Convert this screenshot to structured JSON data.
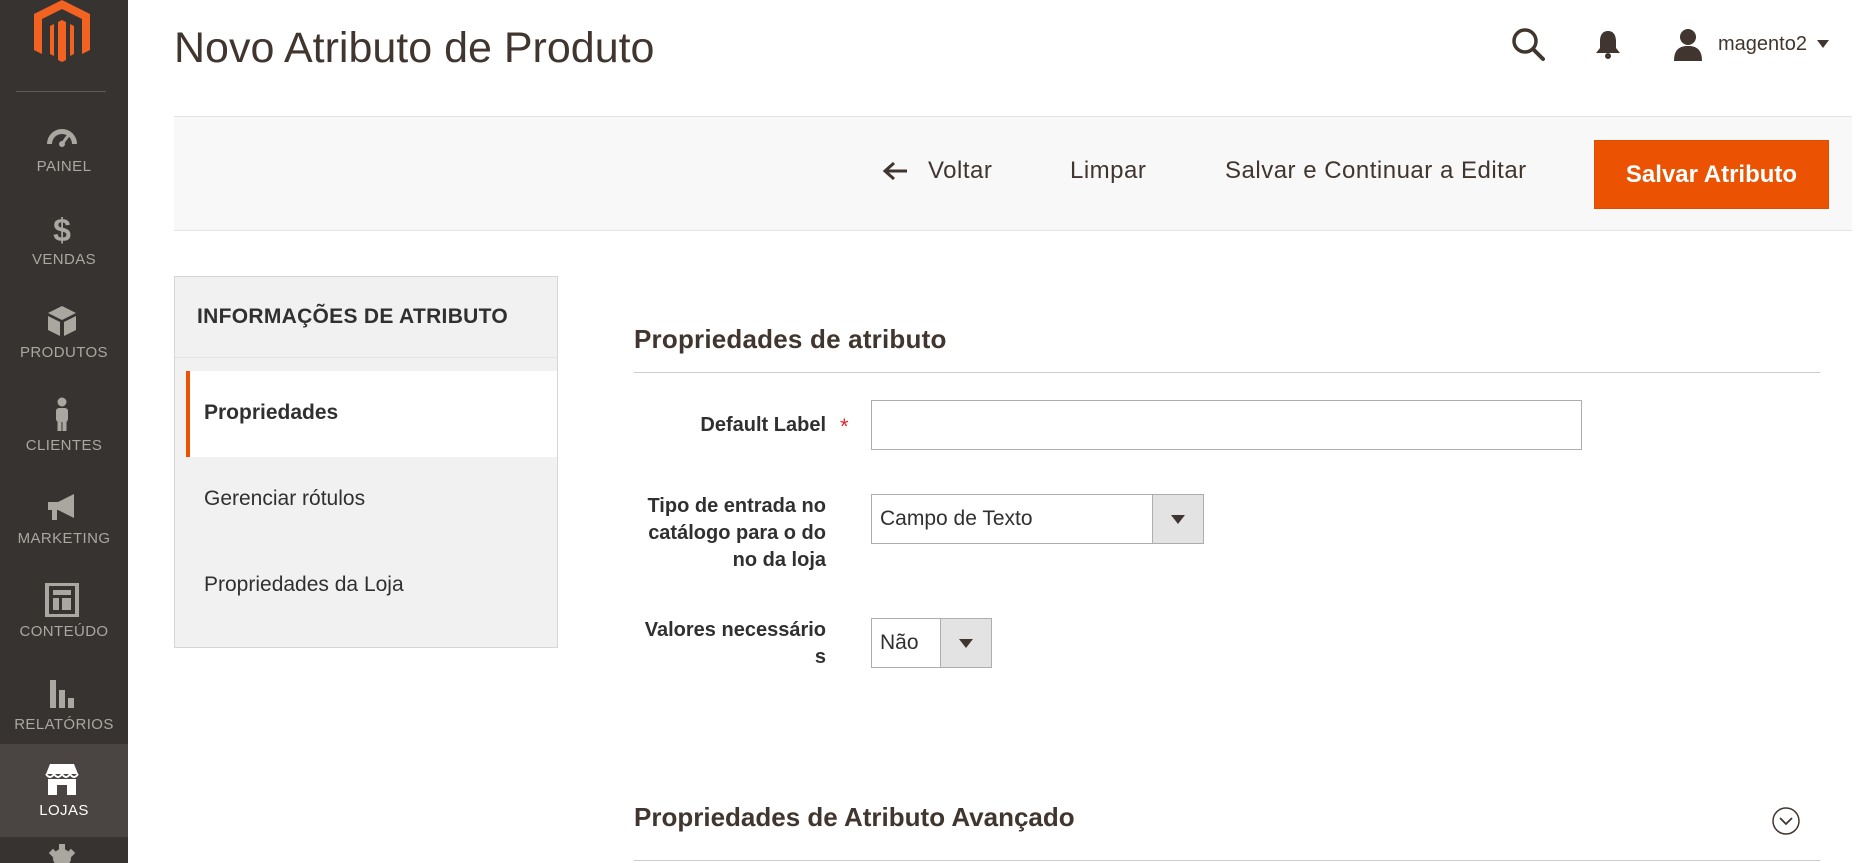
{
  "sidebar": {
    "items": [
      {
        "label": "PAINEL",
        "icon": "dashboard-icon"
      },
      {
        "label": "VENDAS",
        "icon": "dollar-icon"
      },
      {
        "label": "PRODUTOS",
        "icon": "box-icon"
      },
      {
        "label": "CLIENTES",
        "icon": "person-icon"
      },
      {
        "label": "MARKETING",
        "icon": "megaphone-icon"
      },
      {
        "label": "CONTEÚDO",
        "icon": "layout-icon"
      },
      {
        "label": "RELATÓRIOS",
        "icon": "bar-chart-icon"
      },
      {
        "label": "LOJAS",
        "icon": "store-icon",
        "active": true
      }
    ]
  },
  "header": {
    "title": "Novo Atributo de Produto",
    "user_name": "magento2"
  },
  "actions": {
    "back_label": "Voltar",
    "reset_label": "Limpar",
    "save_continue_label": "Salvar e Continuar a Editar",
    "save_label": "Salvar Atributo"
  },
  "tabs": {
    "title": "INFORMAÇÕES DE ATRIBUTO",
    "items": [
      {
        "label": "Propriedades",
        "active": true
      },
      {
        "label": "Gerenciar rótulos"
      },
      {
        "label": "Propriedades da Loja"
      }
    ]
  },
  "form": {
    "section_title": "Propriedades de atributo",
    "default_label": {
      "label": "Default Label",
      "required_mark": "*",
      "value": ""
    },
    "input_type": {
      "label_lines": [
        "Tipo de entrada no",
        "catálogo para o do",
        "no da loja"
      ],
      "value": "Campo de Texto"
    },
    "values_required": {
      "label_lines": [
        "Valores necessário",
        "s"
      ],
      "value": "Não"
    },
    "advanced_title": "Propriedades de Atributo Avançado"
  },
  "colors": {
    "accent": "#eb5202",
    "sidebar_bg": "#373330",
    "sidebar_active_bg": "#4a4542"
  }
}
